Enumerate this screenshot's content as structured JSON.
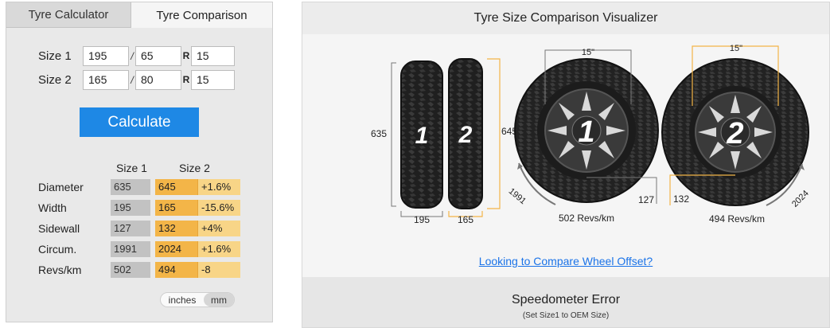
{
  "tabs": [
    {
      "label": "Tyre Calculator",
      "active": false
    },
    {
      "label": "Tyre Comparison",
      "active": true
    }
  ],
  "form": {
    "size1": {
      "label": "Size 1",
      "width": "195",
      "profile": "65",
      "rim": "15"
    },
    "size2": {
      "label": "Size 2",
      "width": "165",
      "profile": "80",
      "rim": "15"
    },
    "slash": "/",
    "r_label": "R",
    "calculate_label": "Calculate"
  },
  "results": {
    "headers": [
      "Size 1",
      "Size 2"
    ],
    "rows": [
      {
        "label": "Diameter",
        "size1": "635",
        "size2": "645",
        "diff": "+1.6%"
      },
      {
        "label": "Width",
        "size1": "195",
        "size2": "165",
        "diff": "-15.6%"
      },
      {
        "label": "Sidewall",
        "size1": "127",
        "size2": "132",
        "diff": "+4%"
      },
      {
        "label": "Circum.",
        "size1": "1991",
        "size2": "2024",
        "diff": "+1.6%"
      },
      {
        "label": "Revs/km",
        "size1": "502",
        "size2": "494",
        "diff": "-8"
      }
    ]
  },
  "units": {
    "inches": "inches",
    "mm": "mm",
    "selected": "mm"
  },
  "visualizer": {
    "title": "Tyre Size Comparison Visualizer",
    "tyre1": {
      "number": "1",
      "height": "635",
      "width": "195",
      "rim": "15\"",
      "sidewall": "127",
      "circumference": "1991",
      "revs": "502 Revs/km"
    },
    "tyre2": {
      "number": "2",
      "height": "645",
      "width": "165",
      "rim": "15\"",
      "sidewall": "132",
      "circumference": "2024",
      "revs": "494 Revs/km"
    },
    "offset_link": "Looking to Compare Wheel Offset?"
  },
  "speedometer": {
    "title": "Speedometer Error",
    "subtitle": "(Set Size1 to OEM Size)"
  },
  "colors": {
    "accent_blue": "#1e88e5",
    "size2_orange": "#f3b548",
    "diff_light_orange": "#f8d587",
    "size1_grey": "#c2c2c2",
    "link_blue": "#1a73e8"
  }
}
